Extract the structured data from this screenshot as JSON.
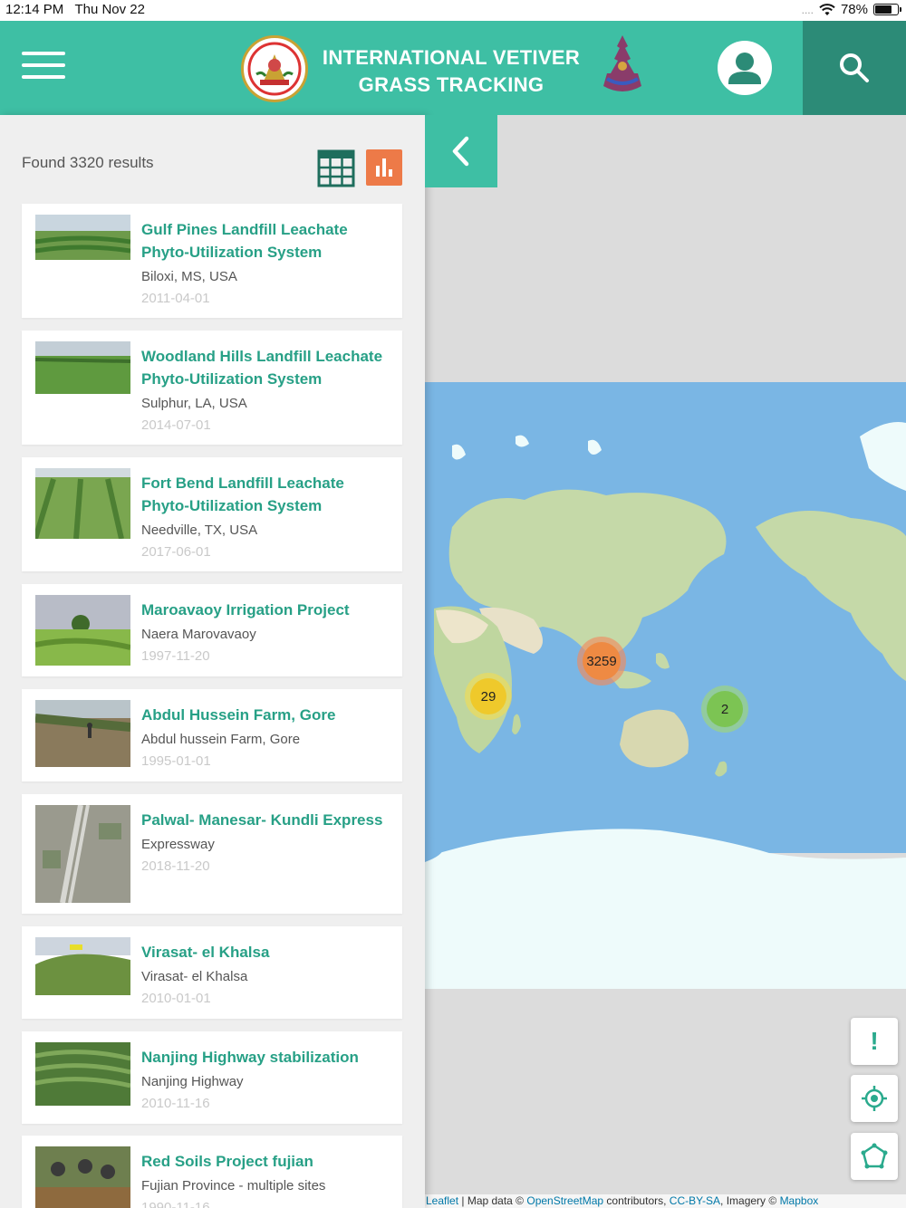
{
  "status_bar": {
    "time": "12:14 PM",
    "date": "Thu Nov 22",
    "signal": "....",
    "battery": "78%"
  },
  "header": {
    "title_line1": "INTERNATIONAL VETIVER",
    "title_line2": "GRASS TRACKING"
  },
  "results": {
    "found_text": "Found 3320 results",
    "items": [
      {
        "title": "Gulf Pines Landfill Leachate Phyto-Utilization System",
        "location": "Biloxi, MS, USA",
        "date": "2011-04-01"
      },
      {
        "title": "Woodland Hills Landfill Leachate Phyto-Utilization System",
        "location": "Sulphur, LA, USA",
        "date": "2014-07-01"
      },
      {
        "title": "Fort Bend Landfill Leachate Phyto-Utilization System",
        "location": "Needville, TX, USA",
        "date": "2017-06-01"
      },
      {
        "title": "Maroavaoy Irrigation Project",
        "location": "Naera Marovavaoy",
        "date": "1997-11-20"
      },
      {
        "title": "Abdul Hussein Farm, Gore",
        "location": "Abdul hussein Farm, Gore",
        "date": "1995-01-01"
      },
      {
        "title": "Palwal- Manesar- Kundli Express",
        "location": "Expressway",
        "date": "2018-11-20"
      },
      {
        "title": "Virasat- el Khalsa",
        "location": "Virasat- el Khalsa",
        "date": "2010-01-01"
      },
      {
        "title": "Nanjing Highway stabilization",
        "location": "Nanjing Highway",
        "date": "2010-11-16"
      },
      {
        "title": "Red Soils Project fujian",
        "location": "Fujian Province - multiple sites",
        "date": "1990-11-16"
      }
    ]
  },
  "map": {
    "clusters": [
      {
        "label": "3259",
        "color": "#ee8a43"
      },
      {
        "label": "29",
        "color": "#efc92b"
      },
      {
        "label": "2",
        "color": "#7cc453"
      }
    ],
    "controls": {
      "alert_label": "!"
    },
    "attribution": {
      "leaflet": "Leaflet",
      "sep1": " | Map data © ",
      "osm": "OpenStreetMap",
      "sep2": " contributors, ",
      "license": "CC-BY-SA",
      "sep3": ", Imagery © ",
      "mapbox": "Mapbox"
    }
  },
  "colors": {
    "primary": "#3ebfa4",
    "primary_dark": "#2c8b77",
    "accent": "#ed7a48",
    "title_text": "#27a086",
    "ocean": "#7ab6e4"
  }
}
